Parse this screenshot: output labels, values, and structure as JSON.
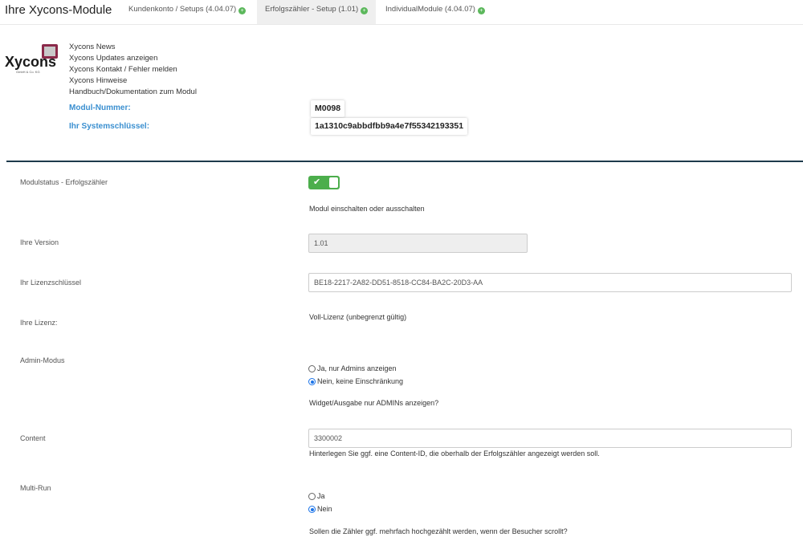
{
  "header": {
    "title": "Ihre Xycons-Module",
    "tabs": [
      {
        "label": "Kundenkonto / Setups (4.04.07)",
        "active": false
      },
      {
        "label": "Erfolgszähler - Setup (1.01)",
        "active": true
      },
      {
        "label": "IndividualModule (4.04.07)",
        "active": false
      }
    ],
    "tab_icon": "plus-circle-icon"
  },
  "logo": {
    "text": "Xycons",
    "subtext": "GmbH & Co. KG"
  },
  "links": [
    "Xycons News",
    "Xycons Updates anzeigen",
    "Xycons Kontakt / Fehler melden",
    "Xycons Hinweise",
    "Handbuch/Dokumentation zum Modul"
  ],
  "module_number": {
    "label": "Modul-Nummer:",
    "value": "M0098"
  },
  "system_key": {
    "label": "Ihr Systemschlüssel:",
    "value": "1a1310c9abbdfbb9a4e7f55342193351"
  },
  "fields": {
    "modulstatus": {
      "label": "Modulstatus - Erfolgszähler",
      "enabled": true,
      "help": "Modul einschalten oder ausschalten"
    },
    "version": {
      "label": "Ihre Version",
      "value": "1.01"
    },
    "license_key": {
      "label": "Ihr Lizenzschlüssel",
      "value": "BE18-2217-2A82-DD51-8518-CC84-BA2C-20D3-AA"
    },
    "license": {
      "label": "Ihre Lizenz:",
      "value": "Voll-Lizenz (unbegrenzt gültig)"
    },
    "admin_mode": {
      "label": "Admin-Modus",
      "options": [
        {
          "label": "Ja, nur Admins anzeigen",
          "checked": false
        },
        {
          "label": "Nein, keine Einschränkung",
          "checked": true
        }
      ],
      "help": "Widget/Ausgabe nur ADMINs anzeigen?"
    },
    "content": {
      "label": "Content",
      "value": "3300002",
      "help": "Hinterlegen Sie ggf. eine Content-ID, die oberhalb der Erfolgszähler angezeigt werden soll."
    },
    "multi_run": {
      "label": "Multi-Run",
      "options": [
        {
          "label": "Ja",
          "checked": false
        },
        {
          "label": "Nein",
          "checked": true
        }
      ],
      "help": "Sollen die Zähler ggf. mehrfach hochgezählt werden, wenn der Besucher scrollt?"
    }
  },
  "colors": {
    "accent": "#3a8fd0",
    "toggle_on": "#4cae4c",
    "divider": "#1e3a4c"
  }
}
